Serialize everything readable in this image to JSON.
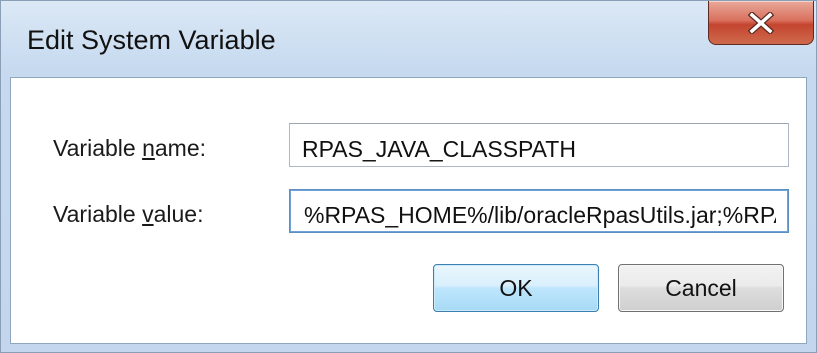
{
  "window": {
    "title": "Edit System Variable",
    "close_icon": "close-x-icon"
  },
  "form": {
    "name_label_pre": "Variable ",
    "name_label_accel": "n",
    "name_label_post": "ame:",
    "name_value": "RPAS_JAVA_CLASSPATH",
    "value_label_pre": "Variable ",
    "value_label_accel": "v",
    "value_label_post": "alue:",
    "value_value": "%RPAS_HOME%/lib/oracleRpasUtils.jar;%RPAS_HOME%/lib/"
  },
  "buttons": {
    "ok_label": "OK",
    "cancel_label": "Cancel"
  },
  "colors": {
    "frame": "#c6d9ef",
    "close_button": "#c4452f",
    "default_button_border": "#3c7fb1"
  }
}
